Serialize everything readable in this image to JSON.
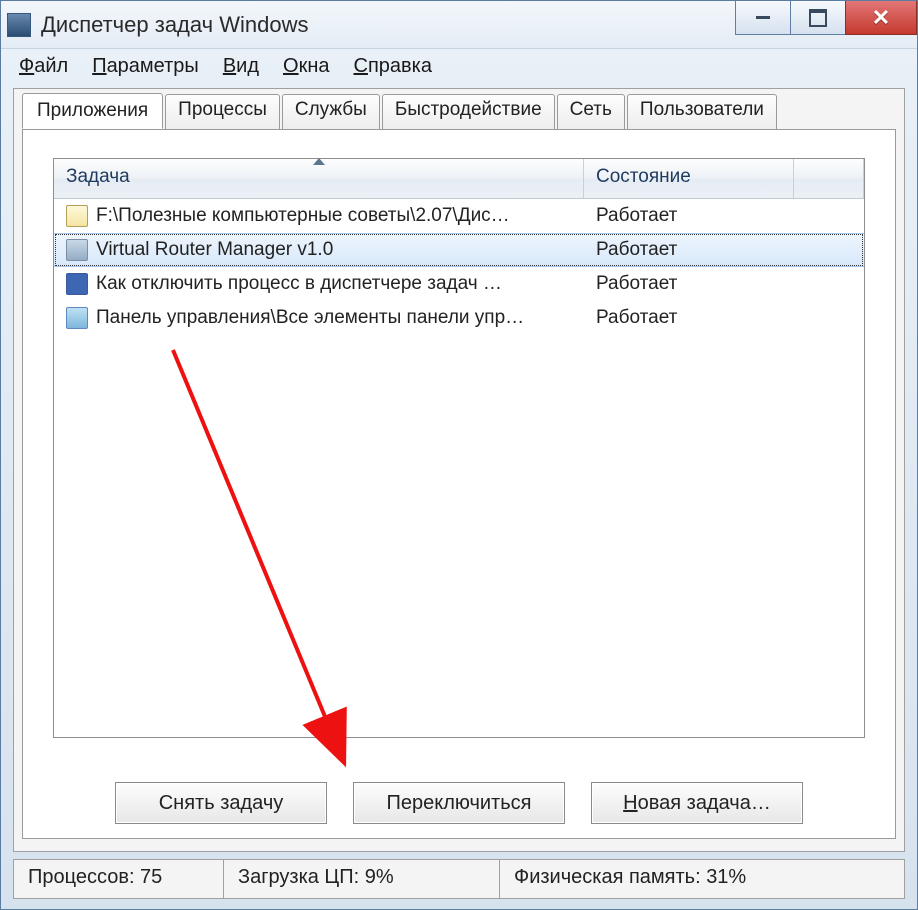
{
  "window": {
    "title": "Диспетчер задач Windows"
  },
  "menu": {
    "file": "Файл",
    "options": "Параметры",
    "view": "Вид",
    "windows": "Окна",
    "help": "Справка"
  },
  "tabs": {
    "applications": "Приложения",
    "processes": "Процессы",
    "services": "Службы",
    "performance": "Быстродействие",
    "networking": "Сеть",
    "users": "Пользователи"
  },
  "columns": {
    "task": "Задача",
    "status": "Состояние"
  },
  "rows": [
    {
      "icon": "folder",
      "task": "F:\\Полезные компьютерные советы\\2.07\\Дис…",
      "status": "Работает",
      "selected": false
    },
    {
      "icon": "generic",
      "task": "Virtual Router Manager v1.0",
      "status": "Работает",
      "selected": true
    },
    {
      "icon": "word",
      "task": "Как отключить процесс в диспетчере задач …",
      "status": "Работает",
      "selected": false
    },
    {
      "icon": "panel",
      "task": "Панель управления\\Все элементы панели упр…",
      "status": "Работает",
      "selected": false
    }
  ],
  "buttons": {
    "end_task": "Снять задачу",
    "switch_to": "Переключиться",
    "new_task": "Новая задача…"
  },
  "status": {
    "processes": "Процессов: 75",
    "cpu": "Загрузка ЦП: 9%",
    "memory": "Физическая память: 31%"
  }
}
